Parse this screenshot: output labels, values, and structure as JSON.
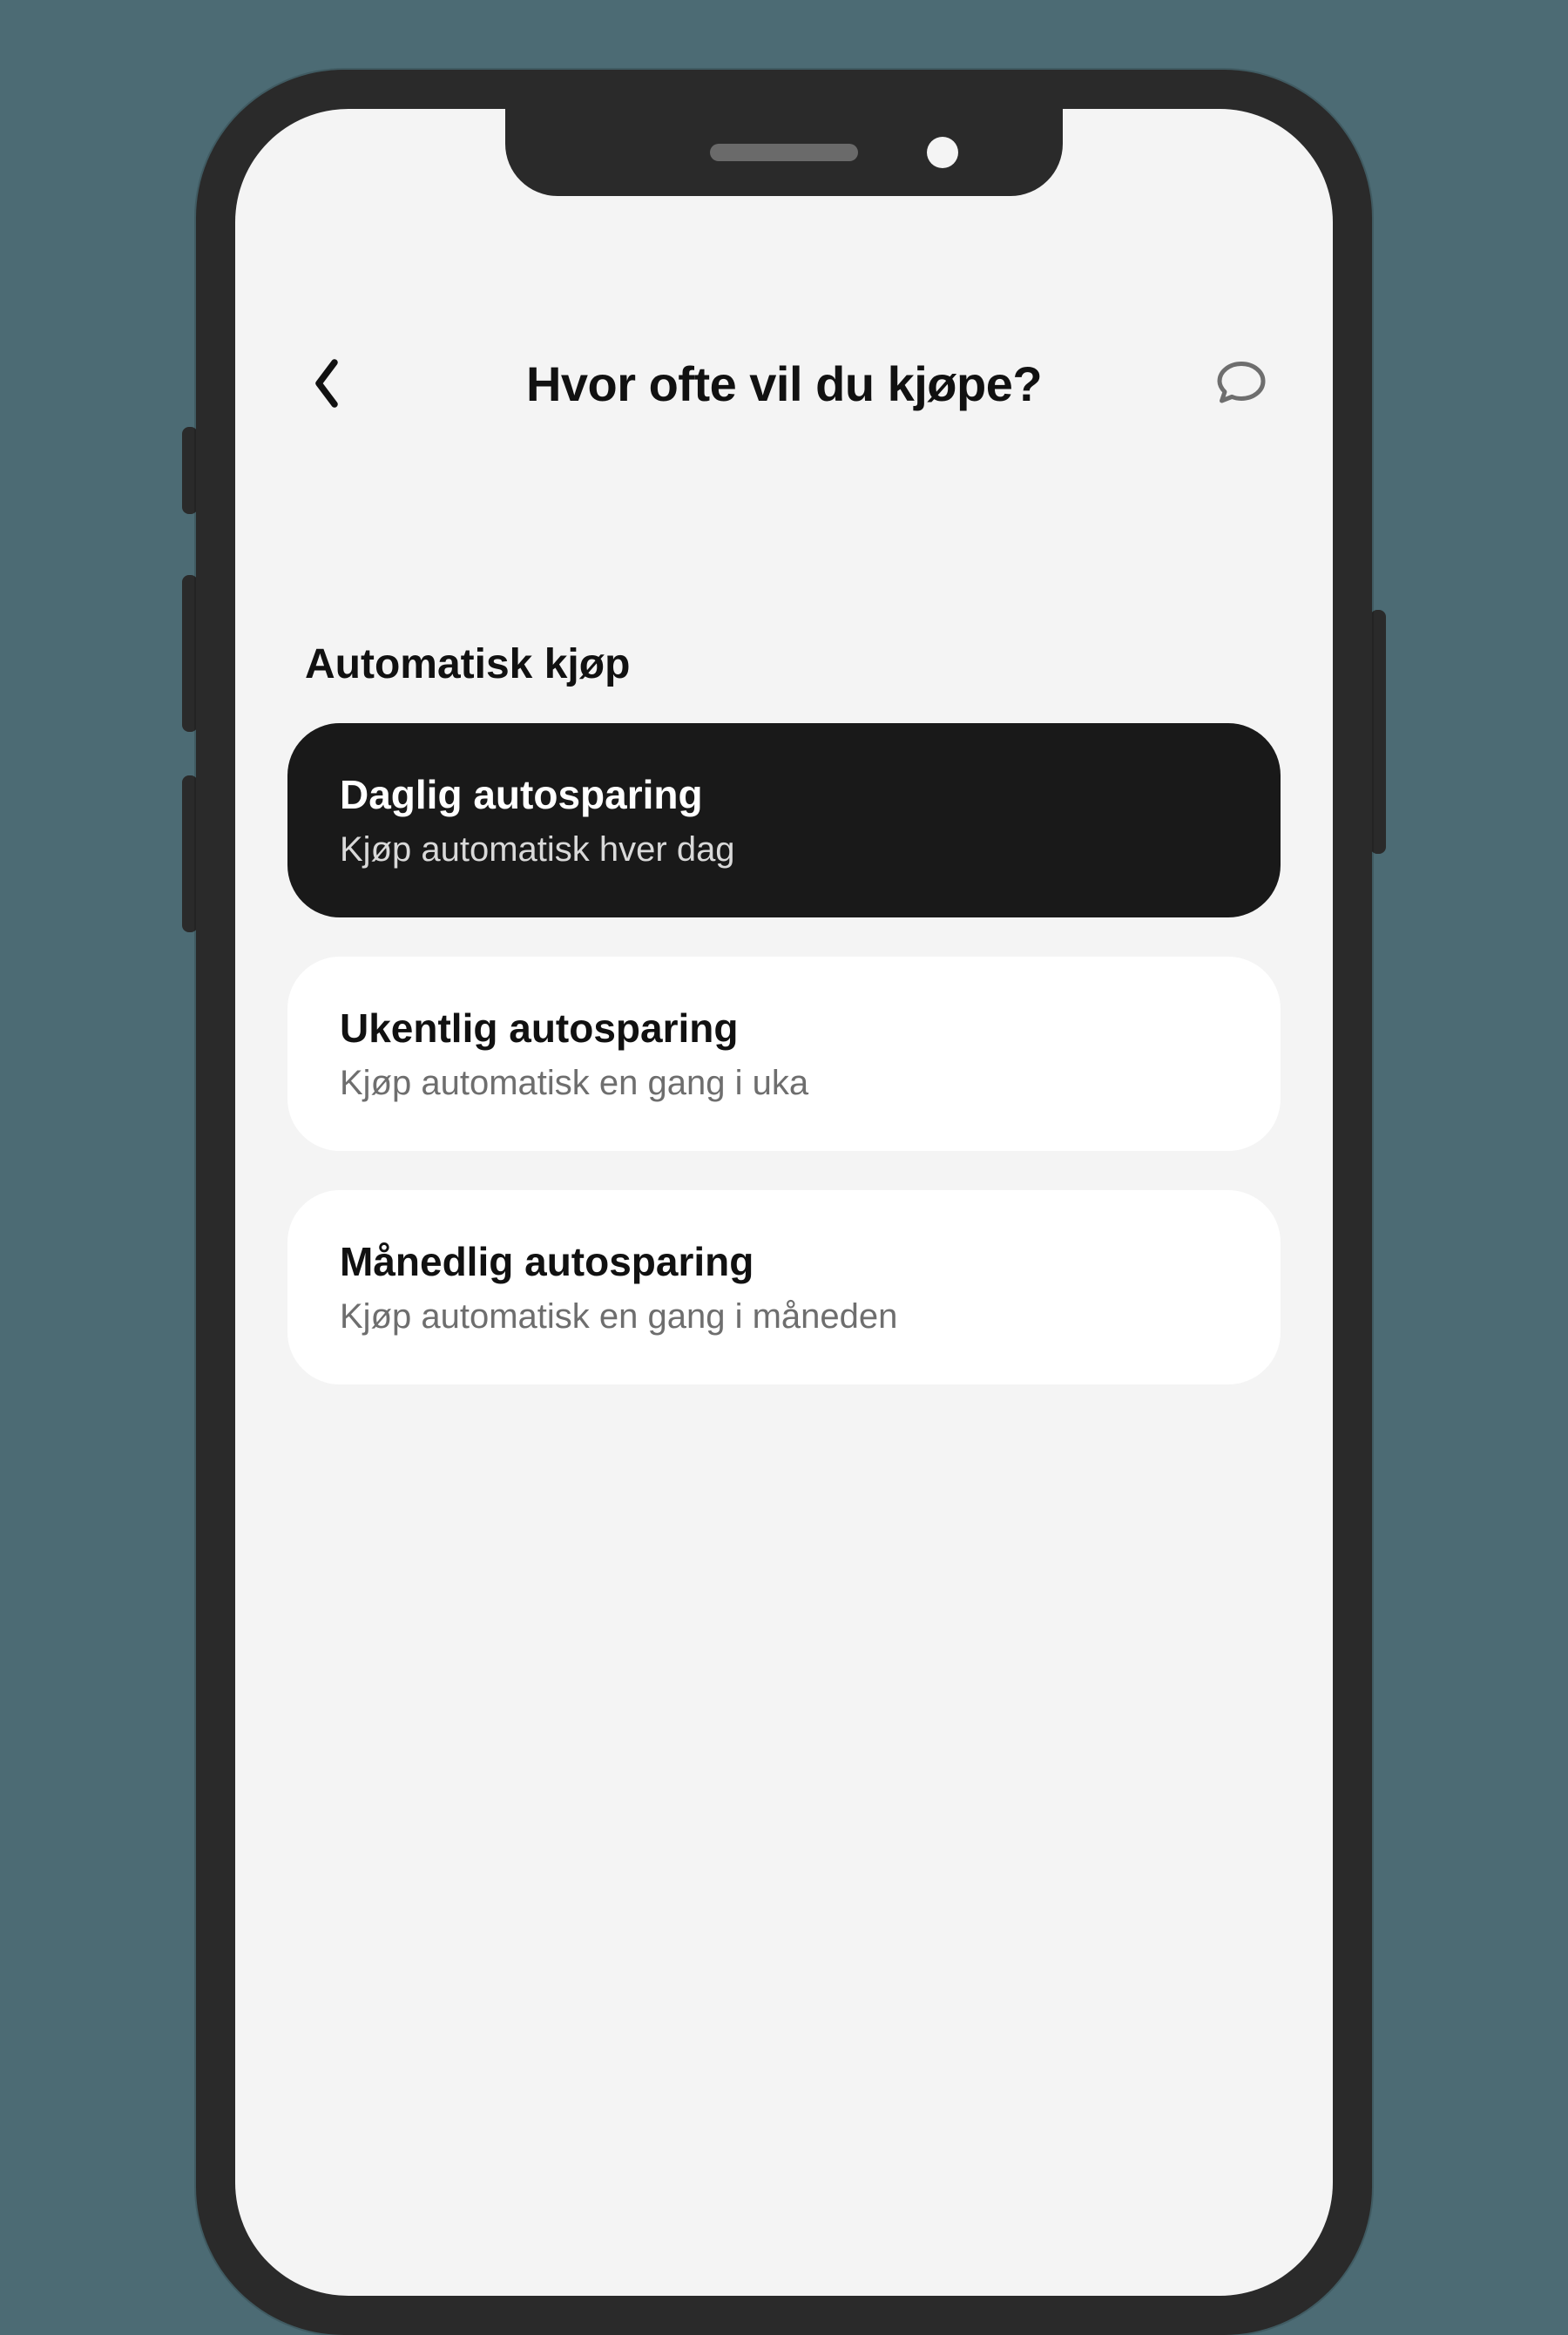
{
  "header": {
    "title": "Hvor ofte vil du kjøpe?"
  },
  "section": {
    "title": "Automatisk kjøp"
  },
  "options": [
    {
      "title": "Daglig autosparing",
      "subtitle": "Kjøp automatisk hver dag",
      "selected": true
    },
    {
      "title": "Ukentlig autosparing",
      "subtitle": "Kjøp automatisk en gang i uka",
      "selected": false
    },
    {
      "title": "Månedlig autosparing",
      "subtitle": "Kjøp automatisk en gang i måneden",
      "selected": false
    }
  ],
  "icons": {
    "back": "chevron-left",
    "chat": "speech-bubble"
  }
}
